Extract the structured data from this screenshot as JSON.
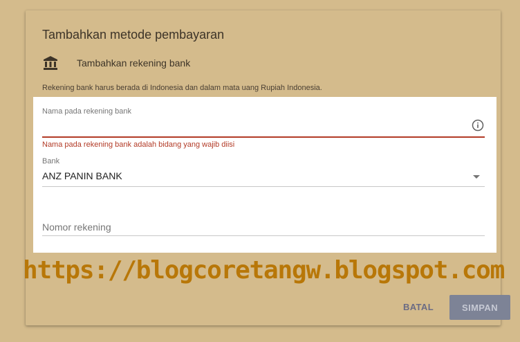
{
  "dialog": {
    "title": "Tambahkan metode pembayaran",
    "bank_option_label": "Tambahkan rekening bank",
    "bank_icon": "bank-icon",
    "notice": "Rekening bank harus berada di Indonesia dan dalam mata uang Rupiah Indonesia."
  },
  "form": {
    "name_field": {
      "label": "Nama pada rekening bank",
      "value": "",
      "error": "Nama pada rekening bank adalah bidang yang wajib diisi",
      "info_icon": "info-icon"
    },
    "bank_field": {
      "label": "Bank",
      "selected": "ANZ PANIN BANK",
      "icon": "dropdown-arrow-icon"
    },
    "account_field": {
      "placeholder": "Nomor rekening",
      "value": ""
    }
  },
  "watermark": "https://blogcoretangw.blogspot.com",
  "actions": {
    "cancel_label": "BATAL",
    "save_label": "SIMPAN"
  },
  "colors": {
    "background": "#d4bb8c",
    "error": "#b23a26",
    "watermark": "#b87708",
    "save_button": "#7d8396",
    "cancel_text": "#6a6b84"
  }
}
